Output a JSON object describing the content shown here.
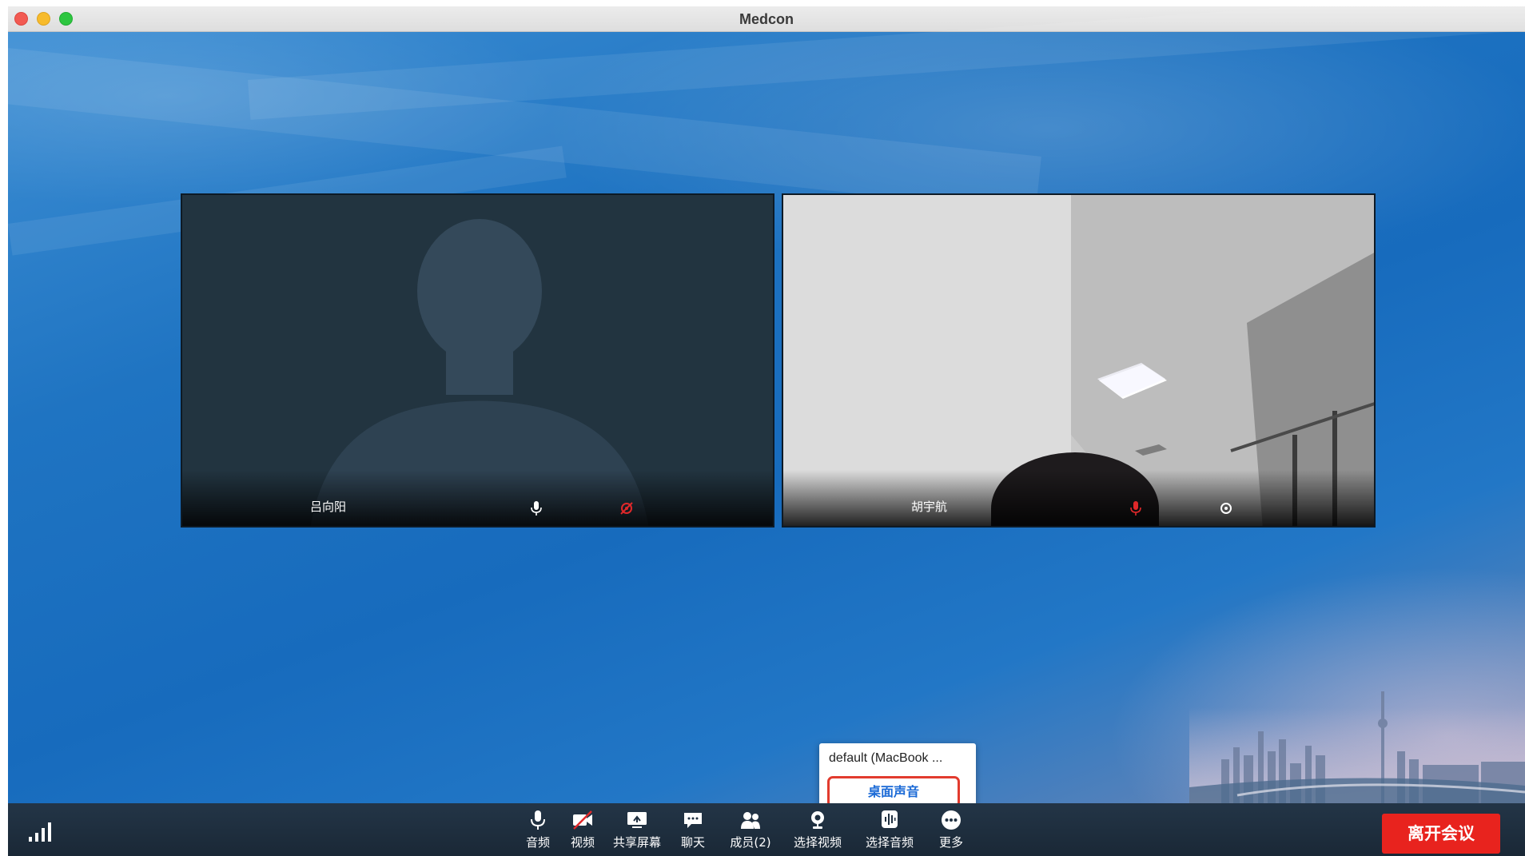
{
  "window": {
    "title": "Medcon"
  },
  "participants": [
    {
      "name": "吕向阳",
      "mic": "on",
      "camera": "off"
    },
    {
      "name": "胡宇航",
      "mic": "muted",
      "camera": "on"
    }
  ],
  "audio_menu": {
    "items": [
      "default (MacBook ...",
      "桌面声音"
    ],
    "highlighted_index": 1
  },
  "toolbar": {
    "items": [
      {
        "label": "音频",
        "icon": "microphone-icon"
      },
      {
        "label": "视频",
        "icon": "camera-off-icon"
      },
      {
        "label": "共享屏幕",
        "icon": "share-screen-icon"
      },
      {
        "label": "聊天",
        "icon": "chat-icon"
      },
      {
        "label": "成员(2)",
        "icon": "members-icon"
      },
      {
        "label": "选择视频",
        "icon": "webcam-icon"
      },
      {
        "label": "选择音频",
        "icon": "audio-waveform-icon"
      },
      {
        "label": "更多",
        "icon": "more-icon"
      }
    ],
    "leave_label": "离开会议"
  },
  "colors": {
    "leave": "#e8231e",
    "highlight_border": "#e23b2e",
    "highlight_text": "#1b6ad6",
    "muted_icon": "#e0282a"
  }
}
